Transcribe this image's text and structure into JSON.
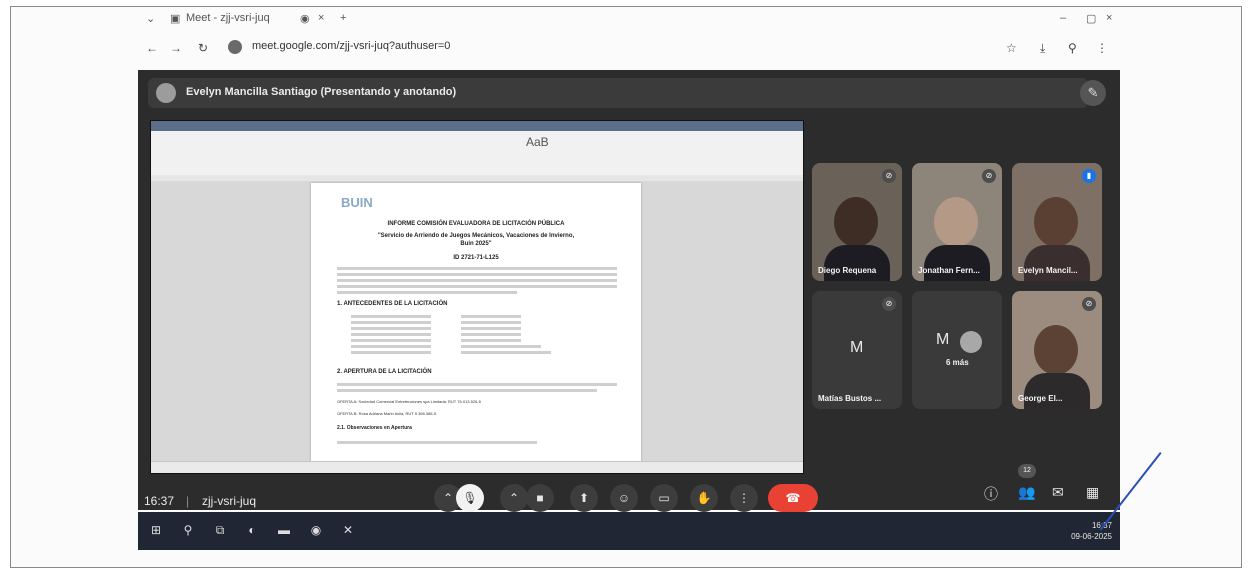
{
  "browser": {
    "tab_title": "Meet - zjj-vsri-juq",
    "url": "meet.google.com/zjj-vsri-juq?authuser=0"
  },
  "presenter": {
    "label": "Evelyn Mancilla Santiago (Presentando y anotando)"
  },
  "document": {
    "logo": "BUIN",
    "title": "INFORME COMISIÓN EVALUADORA DE LICITACIÓN PÚBLICA",
    "subtitle_line1": "\"Servicio de Arriendo de Juegos Mecánicos, Vacaciones de Invierno,",
    "subtitle_line2": "Buin 2025\"",
    "id": "ID 2721-71-L125",
    "section1": "1.  ANTECEDENTES DE LA LICITACIÓN",
    "section2": "2.  APERTURA DE LA LICITACIÓN",
    "offer_a": "OFERTA A: Sociedad Comercial Entretenciones spa Limitada, RUT 76.013.526-5",
    "offer_b": "OFERTA B: Rosa Adriana Marin Avila, RUT 9.398.385-5",
    "subsection": "2.1.  Observaciones en Apertura"
  },
  "participants": [
    {
      "name": "Diego Requena",
      "mic": "muted"
    },
    {
      "name": "Jonathan Fern...",
      "mic": "muted"
    },
    {
      "name": "Evelyn Mancil...",
      "mic": "speaking"
    },
    {
      "name": "Matías Bustos ...",
      "initial": "M",
      "mic": "muted"
    },
    {
      "name": "6 más",
      "initial": "M",
      "mic": "muted"
    },
    {
      "name": "George El...",
      "mic": "muted"
    }
  ],
  "controls": {
    "time": "16:37",
    "separator": "|",
    "meeting_code": "zjj-vsri-juq",
    "people_count": "12"
  },
  "taskbar": {
    "time": "16:37",
    "date": "09-06-2025"
  }
}
